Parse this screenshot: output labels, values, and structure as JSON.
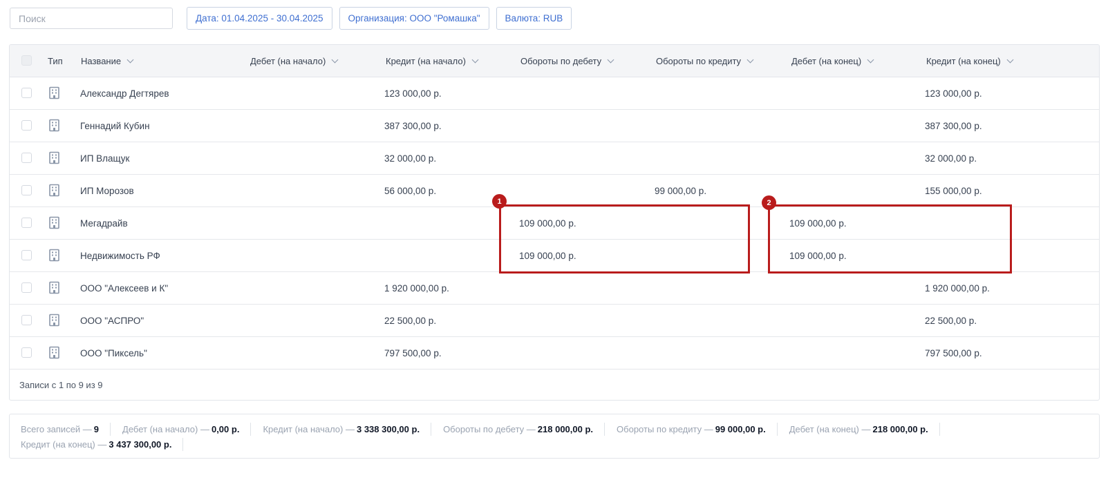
{
  "search": {
    "placeholder": "Поиск",
    "value": ""
  },
  "filters": [
    {
      "label": "Дата: 01.04.2025 - 30.04.2025"
    },
    {
      "label": "Организация: ООО \"Ромашка\""
    },
    {
      "label": "Валюта: RUB"
    }
  ],
  "columns": {
    "type": "Тип",
    "name": "Название",
    "debit_start": "Дебет (на начало)",
    "credit_start": "Кредит (на начало)",
    "turnover_debit": "Обороты по дебету",
    "turnover_credit": "Обороты по кредиту",
    "debit_end": "Дебет (на конец)",
    "credit_end": "Кредит (на конец)"
  },
  "type_icon": "building-icon",
  "rows": [
    {
      "name": "Александр Дегтярев",
      "debit_start": "",
      "credit_start": "123 000,00 р.",
      "turnover_debit": "",
      "turnover_credit": "",
      "debit_end": "",
      "credit_end": "123 000,00 р."
    },
    {
      "name": "Геннадий Кубин",
      "debit_start": "",
      "credit_start": "387 300,00 р.",
      "turnover_debit": "",
      "turnover_credit": "",
      "debit_end": "",
      "credit_end": "387 300,00 р."
    },
    {
      "name": "ИП Влащук",
      "debit_start": "",
      "credit_start": "32 000,00 р.",
      "turnover_debit": "",
      "turnover_credit": "",
      "debit_end": "",
      "credit_end": "32 000,00 р."
    },
    {
      "name": "ИП Морозов",
      "debit_start": "",
      "credit_start": "56 000,00 р.",
      "turnover_debit": "",
      "turnover_credit": "99 000,00 р.",
      "debit_end": "",
      "credit_end": "155 000,00 р."
    },
    {
      "name": "Мегадрайв",
      "debit_start": "",
      "credit_start": "",
      "turnover_debit": "109 000,00 р.",
      "turnover_credit": "",
      "debit_end": "109 000,00 р.",
      "credit_end": ""
    },
    {
      "name": "Недвижимость РФ",
      "debit_start": "",
      "credit_start": "",
      "turnover_debit": "109 000,00 р.",
      "turnover_credit": "",
      "debit_end": "109 000,00 р.",
      "credit_end": ""
    },
    {
      "name": "ООО \"Алексеев и К\"",
      "debit_start": "",
      "credit_start": "1 920 000,00 р.",
      "turnover_debit": "",
      "turnover_credit": "",
      "debit_end": "",
      "credit_end": "1 920 000,00 р."
    },
    {
      "name": "ООО \"АСПРО\"",
      "debit_start": "",
      "credit_start": "22 500,00 р.",
      "turnover_debit": "",
      "turnover_credit": "",
      "debit_end": "",
      "credit_end": "22 500,00 р."
    },
    {
      "name": "ООО \"Пиксель\"",
      "debit_start": "",
      "credit_start": "797 500,00 р.",
      "turnover_debit": "",
      "turnover_credit": "",
      "debit_end": "",
      "credit_end": "797 500,00 р."
    }
  ],
  "pagination": {
    "text": "Записи с 1 по 9 из 9"
  },
  "annotations": {
    "badge_1": "1",
    "badge_2": "2",
    "color": "#b91c1c"
  },
  "summary": {
    "total_label": "Всего записей —",
    "total_value": "9",
    "debit_start_label": "Дебет (на начало) —",
    "debit_start_value": "0,00 р.",
    "credit_start_label": "Кредит (на начало) —",
    "credit_start_value": "3 338 300,00 р.",
    "turnover_debit_label": "Обороты по дебету —",
    "turnover_debit_value": "218 000,00 р.",
    "turnover_credit_label": "Обороты по кредиту —",
    "turnover_credit_value": "99 000,00 р.",
    "debit_end_label": "Дебет (на конец) —",
    "debit_end_value": "218 000,00 р.",
    "credit_end_label": "Кредит (на конец) —",
    "credit_end_value": "3 437 300,00 р."
  },
  "colors": {
    "accent": "#3f6fd1",
    "icon": "#8a96a8",
    "header_bg": "#f4f5f7"
  }
}
